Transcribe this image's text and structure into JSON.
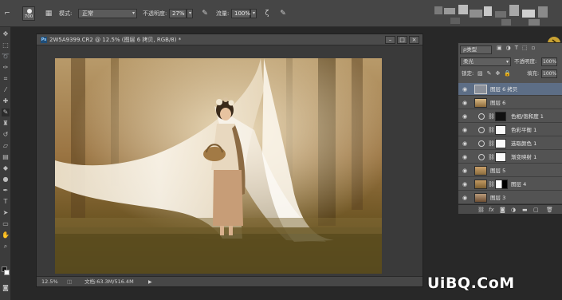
{
  "options_bar": {
    "brush_size": "700",
    "mode_label": "模式:",
    "mode_value": "正常",
    "opacity_label": "不透明度:",
    "opacity_value": "27%",
    "flow_label": "流量:",
    "flow_value": "100%"
  },
  "document": {
    "title": "2W5A9399.CR2 @ 12.5% (图层 6 拷贝, RGB/8) *",
    "zoom": "12.5%",
    "doc_info": "文档:63.3M/516.4M",
    "win_buttons": [
      "–",
      "□",
      "×"
    ]
  },
  "layers_panel": {
    "kind_label": "ρ类型",
    "blend_mode": "柔光",
    "opacity_label": "不透明度:",
    "opacity_value": "100%",
    "lock_label": "锁定:",
    "fill_label": "填充:",
    "fill_value": "100%",
    "layers": [
      {
        "name": "图层 6 拷贝",
        "kind": "pixel",
        "selected": true
      },
      {
        "name": "图层 6",
        "kind": "pixel",
        "selected": false
      },
      {
        "name": "色相/饱和度 1",
        "kind": "adjust",
        "mask": "dark",
        "selected": false
      },
      {
        "name": "色彩平衡 1",
        "kind": "adjust",
        "mask": "white",
        "selected": false
      },
      {
        "name": "选取颜色 1",
        "kind": "adjust",
        "mask": "white",
        "selected": false
      },
      {
        "name": "渐变映射 1",
        "kind": "adjust",
        "mask": "white",
        "selected": false
      },
      {
        "name": "图层 5",
        "kind": "pixel",
        "selected": false
      },
      {
        "name": "图层 4",
        "kind": "pixel-mask",
        "selected": false
      },
      {
        "name": "图层 3",
        "kind": "pixel",
        "selected": false
      }
    ],
    "footer_icons": [
      "link-icon",
      "fx-icon",
      "mask-icon",
      "adjustment-icon",
      "folder-icon",
      "new-layer-icon",
      "trash-icon"
    ]
  },
  "watermark": "UiBQ.CoM",
  "colors": {
    "panel_bg": "#535353",
    "selected_row": "#5d6e86",
    "app_bg": "#282828"
  }
}
